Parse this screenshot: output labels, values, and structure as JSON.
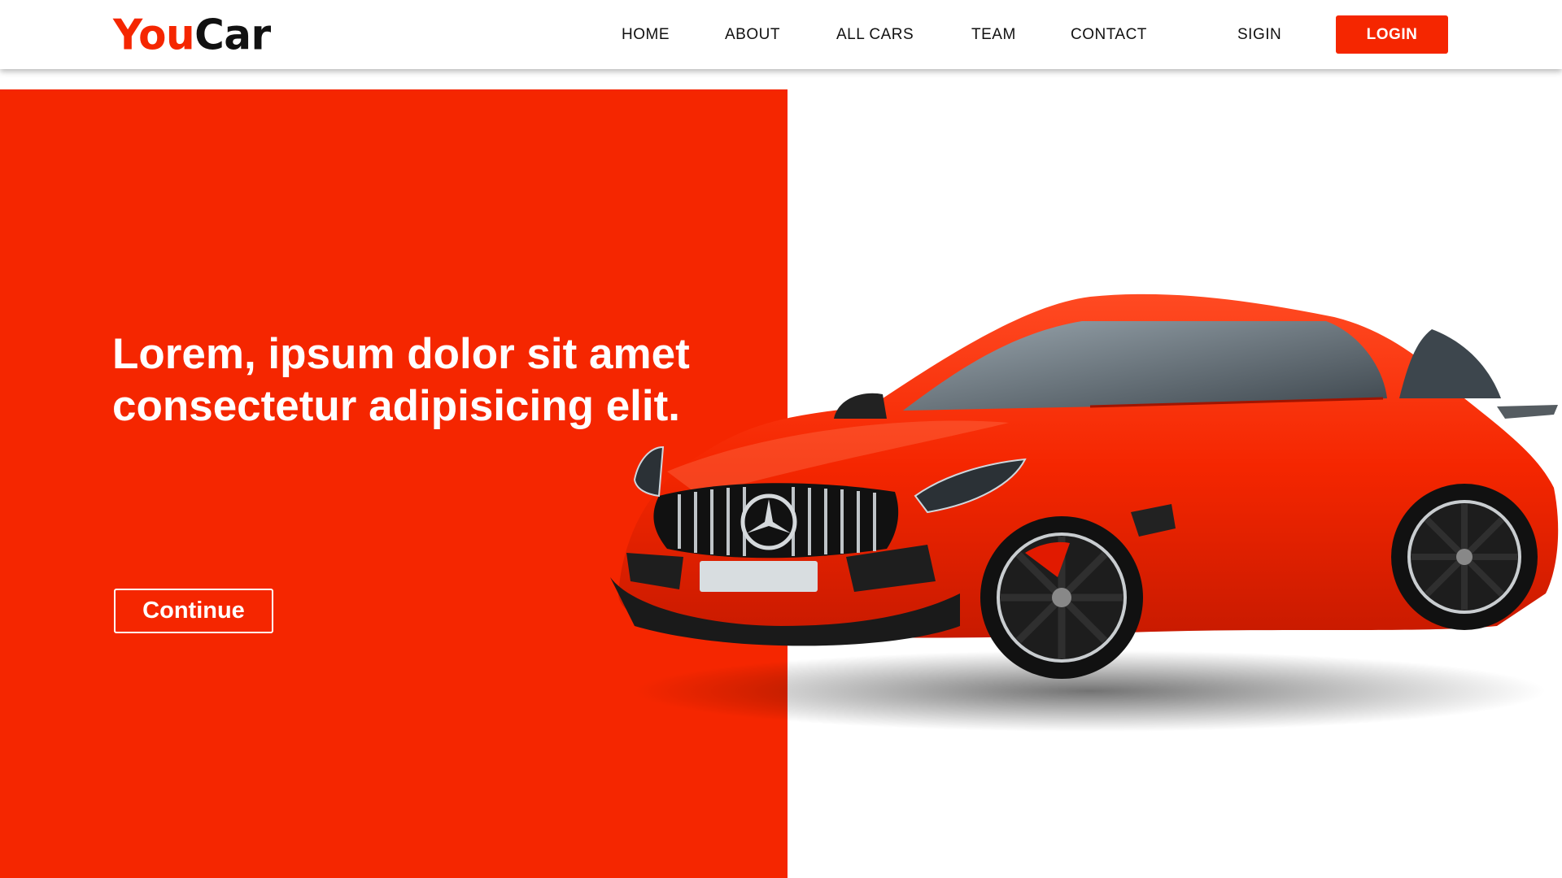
{
  "brand": {
    "part1": "You",
    "part2": "Car",
    "accent_color": "#f52600",
    "dark_color": "#111111"
  },
  "nav": {
    "links": [
      "HOME",
      "ABOUT",
      "ALL CARS",
      "TEAM",
      "CONTACT"
    ],
    "signin_label": "SIGIN",
    "login_label": "LOGIN"
  },
  "hero": {
    "title_line1": "Lorem, ipsum dolor sit amet",
    "title_line2": "consectetur adipisicing elit.",
    "cta_label": "Continue",
    "background_color": "#f52600"
  },
  "image": {
    "subject": "red-sports-car"
  }
}
